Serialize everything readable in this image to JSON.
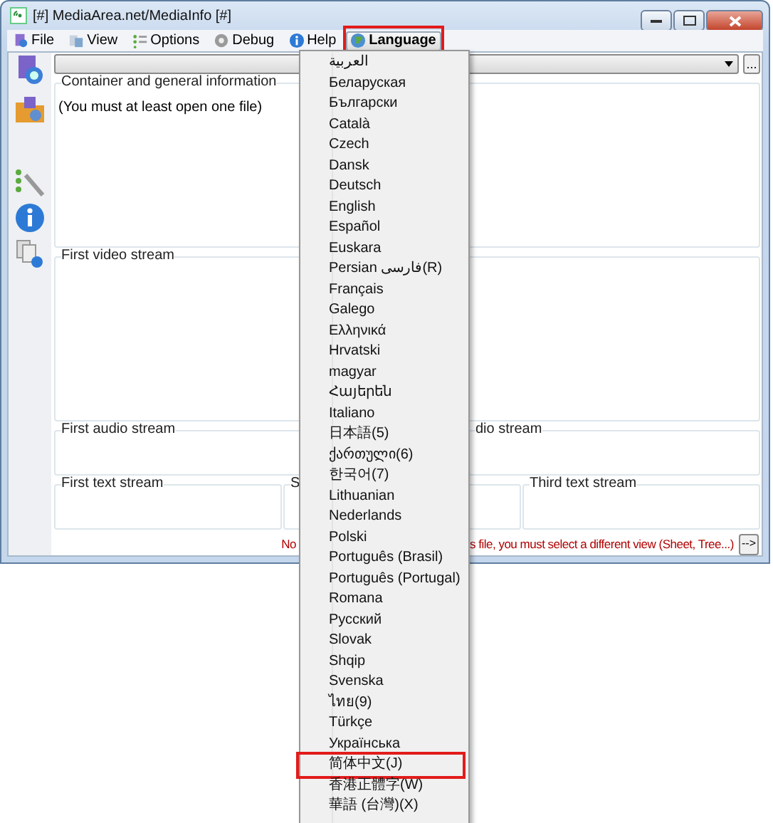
{
  "window": {
    "title": "[#] MediaArea.net/MediaInfo [#]"
  },
  "menubar": {
    "items": [
      {
        "label": "File",
        "selected": false,
        "highlighted": false
      },
      {
        "label": "View",
        "selected": false,
        "highlighted": false
      },
      {
        "label": "Options",
        "selected": false,
        "highlighted": false
      },
      {
        "label": "Debug",
        "selected": false,
        "highlighted": false
      },
      {
        "label": "Help",
        "selected": false,
        "highlighted": false
      },
      {
        "label": "Language",
        "selected": true,
        "highlighted": true
      }
    ]
  },
  "file_combo": {
    "browse_button": "..."
  },
  "container_section": {
    "title": "Container and general information",
    "message": "(You must at least open one file)"
  },
  "video_section": {
    "title": "First video stream"
  },
  "audio_sections": [
    {
      "title": "First audio stream"
    },
    {
      "title": "dio stream"
    }
  ],
  "text_sections": [
    {
      "title": "First text stream"
    },
    {
      "title": "S"
    },
    {
      "title": "Third text stream"
    }
  ],
  "status": {
    "text_before": "No",
    "text_after": "s file, you must select a different view (Sheet, Tree...)",
    "button": "-->"
  },
  "language_menu": {
    "items": [
      {
        "label": "العربية",
        "highlighted": false
      },
      {
        "label": "Беларуская",
        "highlighted": false
      },
      {
        "label": "Български",
        "highlighted": false
      },
      {
        "label": "Català",
        "highlighted": false
      },
      {
        "label": "Czech",
        "highlighted": false
      },
      {
        "label": "Dansk",
        "highlighted": false
      },
      {
        "label": "Deutsch",
        "highlighted": false
      },
      {
        "label": "English",
        "highlighted": false
      },
      {
        "label": "Español",
        "highlighted": false
      },
      {
        "label": "Euskara",
        "highlighted": false
      },
      {
        "label": "Persian  فارسی(R)",
        "highlighted": false
      },
      {
        "label": "Français",
        "highlighted": false
      },
      {
        "label": "Galego",
        "highlighted": false
      },
      {
        "label": "Ελληνικά",
        "highlighted": false
      },
      {
        "label": "Hrvatski",
        "highlighted": false
      },
      {
        "label": "magyar",
        "highlighted": false
      },
      {
        "label": "Հայերեն",
        "highlighted": false
      },
      {
        "label": "Italiano",
        "highlighted": false
      },
      {
        "label": "日本語(5)",
        "highlighted": false
      },
      {
        "label": "ქართული(6)",
        "highlighted": false
      },
      {
        "label": "한국어(7)",
        "highlighted": false
      },
      {
        "label": "Lithuanian",
        "highlighted": false
      },
      {
        "label": "Nederlands",
        "highlighted": false
      },
      {
        "label": "Polski",
        "highlighted": false
      },
      {
        "label": "Português (Brasil)",
        "highlighted": false
      },
      {
        "label": "Português (Portugal)",
        "highlighted": false
      },
      {
        "label": "Romana",
        "highlighted": false
      },
      {
        "label": "Русский",
        "highlighted": false
      },
      {
        "label": "Slovak",
        "highlighted": false
      },
      {
        "label": "Shqip",
        "highlighted": false
      },
      {
        "label": "Svenska",
        "highlighted": false
      },
      {
        "label": "ไทย(9)",
        "highlighted": false
      },
      {
        "label": "Türkçe",
        "highlighted": false
      },
      {
        "label": "Українська",
        "highlighted": false
      },
      {
        "label": "简体中文(J)",
        "highlighted": true
      },
      {
        "label": "香港正體字(W)",
        "highlighted": false
      },
      {
        "label": "華語 (台灣)(X)",
        "highlighted": false
      }
    ]
  }
}
